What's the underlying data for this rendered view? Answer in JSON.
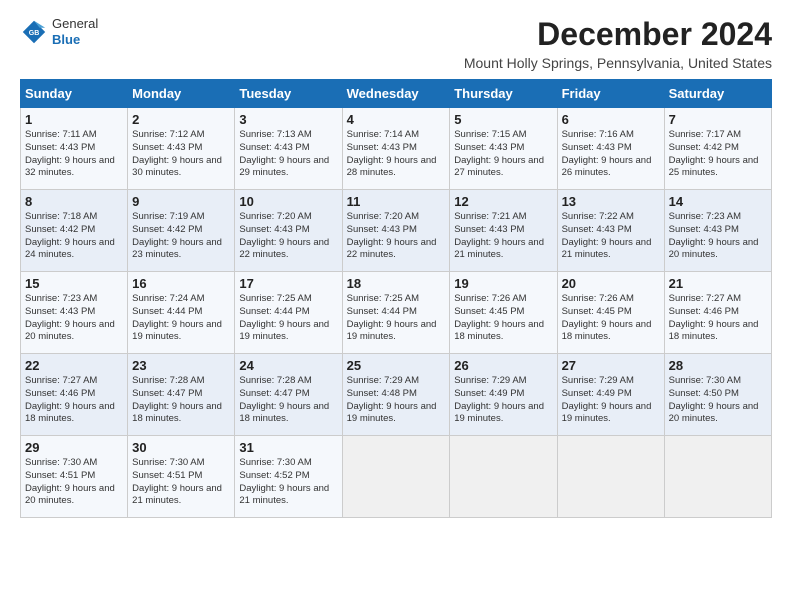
{
  "header": {
    "logo_general": "General",
    "logo_blue": "Blue",
    "main_title": "December 2024",
    "subtitle": "Mount Holly Springs, Pennsylvania, United States"
  },
  "weekdays": [
    "Sunday",
    "Monday",
    "Tuesday",
    "Wednesday",
    "Thursday",
    "Friday",
    "Saturday"
  ],
  "weeks": [
    [
      {
        "day": "1",
        "sunrise": "7:11 AM",
        "sunset": "4:43 PM",
        "daylight": "9 hours and 32 minutes."
      },
      {
        "day": "2",
        "sunrise": "7:12 AM",
        "sunset": "4:43 PM",
        "daylight": "9 hours and 30 minutes."
      },
      {
        "day": "3",
        "sunrise": "7:13 AM",
        "sunset": "4:43 PM",
        "daylight": "9 hours and 29 minutes."
      },
      {
        "day": "4",
        "sunrise": "7:14 AM",
        "sunset": "4:43 PM",
        "daylight": "9 hours and 28 minutes."
      },
      {
        "day": "5",
        "sunrise": "7:15 AM",
        "sunset": "4:43 PM",
        "daylight": "9 hours and 27 minutes."
      },
      {
        "day": "6",
        "sunrise": "7:16 AM",
        "sunset": "4:43 PM",
        "daylight": "9 hours and 26 minutes."
      },
      {
        "day": "7",
        "sunrise": "7:17 AM",
        "sunset": "4:42 PM",
        "daylight": "9 hours and 25 minutes."
      }
    ],
    [
      {
        "day": "8",
        "sunrise": "7:18 AM",
        "sunset": "4:42 PM",
        "daylight": "9 hours and 24 minutes."
      },
      {
        "day": "9",
        "sunrise": "7:19 AM",
        "sunset": "4:42 PM",
        "daylight": "9 hours and 23 minutes."
      },
      {
        "day": "10",
        "sunrise": "7:20 AM",
        "sunset": "4:43 PM",
        "daylight": "9 hours and 22 minutes."
      },
      {
        "day": "11",
        "sunrise": "7:20 AM",
        "sunset": "4:43 PM",
        "daylight": "9 hours and 22 minutes."
      },
      {
        "day": "12",
        "sunrise": "7:21 AM",
        "sunset": "4:43 PM",
        "daylight": "9 hours and 21 minutes."
      },
      {
        "day": "13",
        "sunrise": "7:22 AM",
        "sunset": "4:43 PM",
        "daylight": "9 hours and 21 minutes."
      },
      {
        "day": "14",
        "sunrise": "7:23 AM",
        "sunset": "4:43 PM",
        "daylight": "9 hours and 20 minutes."
      }
    ],
    [
      {
        "day": "15",
        "sunrise": "7:23 AM",
        "sunset": "4:43 PM",
        "daylight": "9 hours and 20 minutes."
      },
      {
        "day": "16",
        "sunrise": "7:24 AM",
        "sunset": "4:44 PM",
        "daylight": "9 hours and 19 minutes."
      },
      {
        "day": "17",
        "sunrise": "7:25 AM",
        "sunset": "4:44 PM",
        "daylight": "9 hours and 19 minutes."
      },
      {
        "day": "18",
        "sunrise": "7:25 AM",
        "sunset": "4:44 PM",
        "daylight": "9 hours and 19 minutes."
      },
      {
        "day": "19",
        "sunrise": "7:26 AM",
        "sunset": "4:45 PM",
        "daylight": "9 hours and 18 minutes."
      },
      {
        "day": "20",
        "sunrise": "7:26 AM",
        "sunset": "4:45 PM",
        "daylight": "9 hours and 18 minutes."
      },
      {
        "day": "21",
        "sunrise": "7:27 AM",
        "sunset": "4:46 PM",
        "daylight": "9 hours and 18 minutes."
      }
    ],
    [
      {
        "day": "22",
        "sunrise": "7:27 AM",
        "sunset": "4:46 PM",
        "daylight": "9 hours and 18 minutes."
      },
      {
        "day": "23",
        "sunrise": "7:28 AM",
        "sunset": "4:47 PM",
        "daylight": "9 hours and 18 minutes."
      },
      {
        "day": "24",
        "sunrise": "7:28 AM",
        "sunset": "4:47 PM",
        "daylight": "9 hours and 18 minutes."
      },
      {
        "day": "25",
        "sunrise": "7:29 AM",
        "sunset": "4:48 PM",
        "daylight": "9 hours and 19 minutes."
      },
      {
        "day": "26",
        "sunrise": "7:29 AM",
        "sunset": "4:49 PM",
        "daylight": "9 hours and 19 minutes."
      },
      {
        "day": "27",
        "sunrise": "7:29 AM",
        "sunset": "4:49 PM",
        "daylight": "9 hours and 19 minutes."
      },
      {
        "day": "28",
        "sunrise": "7:30 AM",
        "sunset": "4:50 PM",
        "daylight": "9 hours and 20 minutes."
      }
    ],
    [
      {
        "day": "29",
        "sunrise": "7:30 AM",
        "sunset": "4:51 PM",
        "daylight": "9 hours and 20 minutes."
      },
      {
        "day": "30",
        "sunrise": "7:30 AM",
        "sunset": "4:51 PM",
        "daylight": "9 hours and 21 minutes."
      },
      {
        "day": "31",
        "sunrise": "7:30 AM",
        "sunset": "4:52 PM",
        "daylight": "9 hours and 21 minutes."
      },
      null,
      null,
      null,
      null
    ]
  ],
  "labels": {
    "sunrise": "Sunrise:",
    "sunset": "Sunset:",
    "daylight": "Daylight:"
  }
}
